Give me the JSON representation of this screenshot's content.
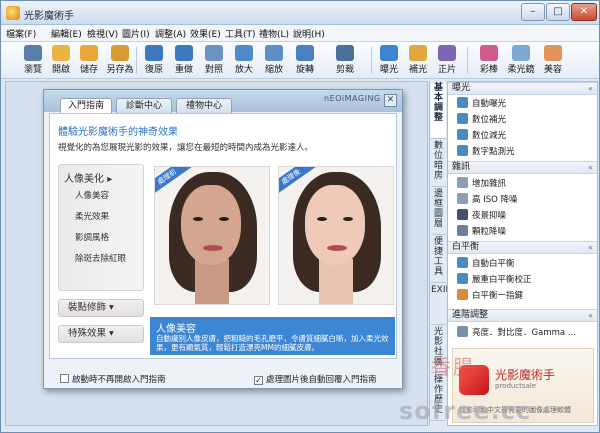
{
  "window": {
    "title": "光影魔術手",
    "minimize": "–",
    "maximize": "□",
    "close": "✕"
  },
  "menu": [
    "檔案(F)",
    "編輯(E)",
    "檢視(V)",
    "圖片(I)",
    "調整(A)",
    "效果(E)",
    "工具(T)",
    "禮物(L)",
    "說明(H)"
  ],
  "toolbar": [
    "瀏覽",
    "開啟",
    "儲存",
    "另存為",
    "復原",
    "重做",
    "對照",
    "放大",
    "縮放",
    "旋轉",
    "剪裁",
    "曝光",
    "補光",
    "正片",
    "彩棒",
    "柔光鏡",
    "美容"
  ],
  "dialog": {
    "brand": "nEOiMAGING",
    "close": "✕",
    "tabs": [
      "入門指南",
      "診斷中心",
      "禮物中心"
    ],
    "intro_title": "體驗光影魔術手的神奇效果",
    "intro_desc": "視覺化的為您展現光影的效果，讓您在最短的時間內成為光影達人。",
    "category": {
      "title": "人像美化",
      "items": [
        "人像美容",
        "柔光效果",
        "影調風格",
        "除斑去除紅眼"
      ]
    },
    "buttons": [
      "裝點修飾",
      "特殊效果"
    ],
    "badges": [
      "處理前",
      "處理後"
    ],
    "info_title": "人像美容",
    "info_desc": "自動識別人像皮膚，把粗糙的毛孔磨平，令膚質細膩白晰，加入柔光效果，更有顯氣質，輕鬆打造漂亮MM的細膩皮膚。",
    "checkbox_left": "啟動時不再開啟入門指南",
    "checkbox_right": "處理圖片後自動回覆入門指南",
    "checkbox_right_checked": "✓"
  },
  "vtabs": [
    "基本調整",
    "數位暗房",
    "邊框圖層",
    "便捷工具",
    "EXIF",
    "光影社區",
    "操作歷史"
  ],
  "rpanel": {
    "sections": [
      {
        "title": "曝光",
        "chev": "«",
        "items": [
          "自動曝光",
          "數位補光",
          "數位減光",
          "數字點測光"
        ]
      },
      {
        "title": "雜訊",
        "chev": "«",
        "items": [
          "增加雜訊",
          "高 ISO 降噪",
          "夜景抑噪",
          "顆粒降噪"
        ]
      },
      {
        "title": "白平衡",
        "chev": "«",
        "items": [
          "自動白平衡",
          "嚴重白平衡校正",
          "白平衡一指鍵"
        ]
      },
      {
        "title": "進階調整",
        "chev": "«",
        "items": [
          "亮度．對比度．Gamma ..."
        ]
      }
    ],
    "ad": {
      "name": "光影魔術手",
      "sub": "productsale",
      "line": "找影印和中文最需要的圖像處理軟體"
    }
  },
  "watermark": {
    "top": "香腸",
    "bottom": "sofree.cc"
  },
  "colors": {
    "accent": "#3d86d4",
    "title_blue": "#2c74c7"
  }
}
